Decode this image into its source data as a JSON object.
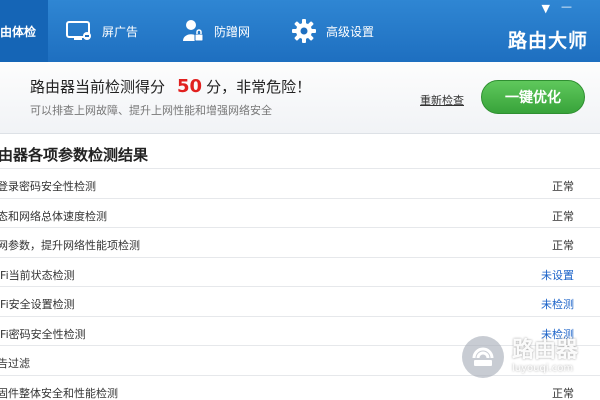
{
  "header": {
    "tabs": [
      {
        "label": "由体检",
        "icon": "checkup-icon",
        "active": true
      },
      {
        "label": "屏广告",
        "icon": "monitor-icon"
      },
      {
        "label": "防蹭网",
        "icon": "user-lock-icon"
      },
      {
        "label": "高级设置",
        "icon": "gear-icon"
      }
    ],
    "brand": "路由大师",
    "window_controls": {
      "menu": "▼",
      "minimize": "—"
    }
  },
  "summary": {
    "title_prefix": "路由器当前检测得分",
    "score": "50",
    "title_suffix": "分，非常危险！",
    "subtitle": "可以排查上网故障、提升上网性能和增强网络安全",
    "recheck_label": "重新检查",
    "optimize_label": "一键优化"
  },
  "results": {
    "title": "由器各项参数检测结果",
    "rows": [
      {
        "label": "登录密码安全性检测",
        "status": "正常",
        "kind": "normal"
      },
      {
        "label": "态和网络总体速度检测",
        "status": "正常",
        "kind": "normal"
      },
      {
        "label": "网参数，提升网络性能项检测",
        "status": "正常",
        "kind": "normal"
      },
      {
        "label": "iFi当前状态检测",
        "status": "未设置",
        "kind": "warn"
      },
      {
        "label": "iFi安全设置检测",
        "status": "未检测",
        "kind": "warn"
      },
      {
        "label": "iFi密码安全性检测",
        "status": "未检测",
        "kind": "warn"
      },
      {
        "label": "告过滤",
        "status": "",
        "kind": "warn"
      },
      {
        "label": "固件整体安全和性能检测",
        "status": "正常",
        "kind": "normal"
      }
    ]
  },
  "watermark": {
    "title": "路由器",
    "url": "luyouqi.com"
  },
  "colors": {
    "header_blue": "#1e6fc0",
    "score_red": "#e1201f",
    "button_green": "#38a33a",
    "link_blue": "#1a62c8"
  }
}
